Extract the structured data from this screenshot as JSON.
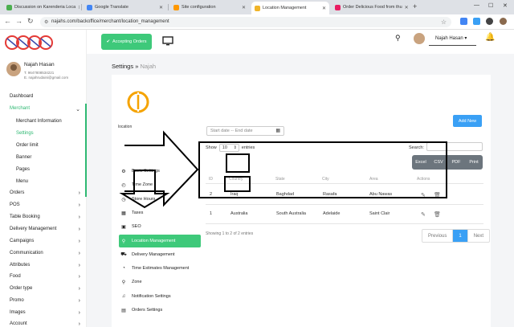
{
  "browser": {
    "tabs": [
      {
        "title": "Discussion on Karenderia Loca",
        "fav": "#4caf50"
      },
      {
        "title": "Google Translate",
        "fav": "#4285f4"
      },
      {
        "title": "Site configuration",
        "fav": "#ff9800"
      },
      {
        "title": "Location Management",
        "fav": "#f0b429"
      },
      {
        "title": "Order Delicious Food from thu",
        "fav": "#e91e63"
      }
    ],
    "new_tab": "+",
    "url": "najahs.com/backoffice/merchant/location_management"
  },
  "user": {
    "name": "Najah Hasan",
    "phone": "T. 9647808534221",
    "email": "E. najahrudaini@gmail.com"
  },
  "sidebar": {
    "items": [
      {
        "label": "Dashboard",
        "chev": ""
      },
      {
        "label": "Merchant",
        "chev": "⌄"
      },
      {
        "label": "Merchant Information",
        "chev": ""
      },
      {
        "label": "Settings",
        "chev": ""
      },
      {
        "label": "Order limit",
        "chev": ""
      },
      {
        "label": "Banner",
        "chev": ""
      },
      {
        "label": "Pages",
        "chev": ""
      },
      {
        "label": "Menu",
        "chev": ""
      },
      {
        "label": "Orders",
        "chev": "›"
      },
      {
        "label": "POS",
        "chev": "›"
      },
      {
        "label": "Table Booking",
        "chev": "›"
      },
      {
        "label": "Delivery Management",
        "chev": "›"
      },
      {
        "label": "Campaigns",
        "chev": "›"
      },
      {
        "label": "Communication",
        "chev": "›"
      },
      {
        "label": "Attributes",
        "chev": "›"
      },
      {
        "label": "Food",
        "chev": "›"
      },
      {
        "label": "Order type",
        "chev": "›"
      },
      {
        "label": "Promo",
        "chev": "›"
      },
      {
        "label": "Images",
        "chev": "›"
      },
      {
        "label": "Account",
        "chev": "›"
      }
    ]
  },
  "header": {
    "accept_orders": "Accepting Orders",
    "user_name": "Najah Hasan",
    "caret": "▾"
  },
  "breadcrumb": {
    "root": "Settings",
    "sep": "»",
    "current": "Najah"
  },
  "location_label": "location",
  "settings_menu": [
    {
      "label": "Basic Settings",
      "icon": "⚙"
    },
    {
      "label": "Store Hours",
      "icon": "◷"
    },
    {
      "label": "Time Zone",
      "icon": "◴"
    },
    {
      "label": "Taxes",
      "icon": "▦"
    },
    {
      "label": "SEO",
      "icon": "▣"
    },
    {
      "label": "Location Management",
      "icon": "⚲"
    },
    {
      "label": "Delivery Management",
      "icon": "⛟"
    },
    {
      "label": "Time Estimates Management",
      "icon": "◔"
    },
    {
      "label": "Zone",
      "icon": "⚲"
    },
    {
      "label": "Notification Settings",
      "icon": "♫"
    },
    {
      "label": "Orders Settings",
      "icon": "▤"
    }
  ],
  "filters": {
    "date_placeholder": "Start date -- End date",
    "add_new": "Add New",
    "show_label": "Show",
    "show_value": "10",
    "entries_label": "entries",
    "search_label": "Search:"
  },
  "export_buttons": [
    "Excel",
    "CSV",
    "PDF",
    "Print"
  ],
  "table": {
    "columns": [
      "ID",
      "Country",
      "State",
      "City",
      "Area",
      "Actions"
    ],
    "rows": [
      {
        "id": "2",
        "country": "Iraq",
        "state": "Baghdad",
        "city": "Rasafa",
        "area": "Abu Nawas"
      },
      {
        "id": "1",
        "country": "Australia",
        "state": "South Australia",
        "city": "Adelaide",
        "area": "Saint Clair"
      }
    ],
    "showing": "Showing 1 to 2 of 2 entries"
  },
  "pagination": {
    "prev": "Previous",
    "current": "1",
    "next": "Next"
  },
  "colors": {
    "accent": "#2eb872",
    "button_green": "#3ec97a",
    "blue": "#3aa0f5"
  }
}
